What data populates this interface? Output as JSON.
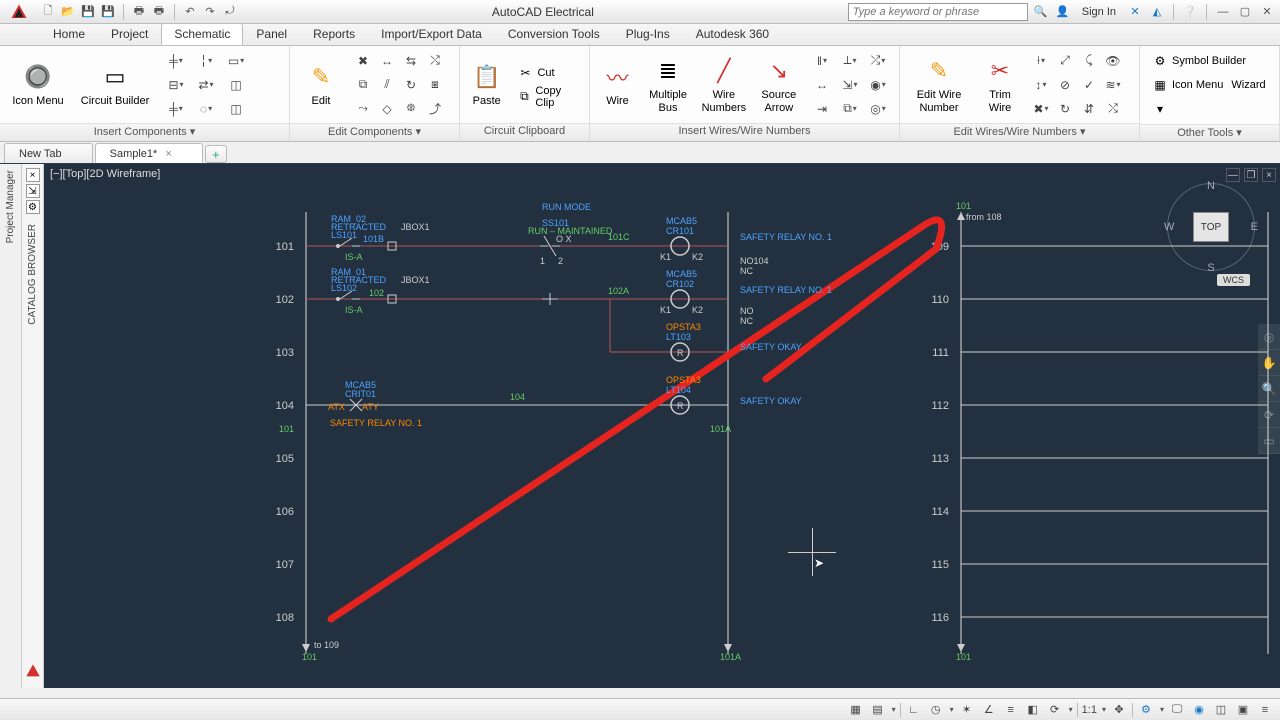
{
  "app": {
    "title": "AutoCAD Electrical",
    "search_placeholder": "Type a keyword or phrase",
    "signin": "Sign In"
  },
  "tabs": {
    "items": [
      "Home",
      "Project",
      "Schematic",
      "Panel",
      "Reports",
      "Import/Export Data",
      "Conversion Tools",
      "Plug-Ins",
      "Autodesk 360"
    ],
    "active": 2
  },
  "ribbon": {
    "insert_components": {
      "title": "Insert Components ▾",
      "icon_menu": "Icon Menu",
      "circuit_builder": "Circuit Builder"
    },
    "edit_components": {
      "title": "Edit Components ▾",
      "edit": "Edit"
    },
    "clipboard": {
      "title": "Circuit Clipboard",
      "paste": "Paste",
      "cut": "Cut",
      "copy": "Copy Clip"
    },
    "insert_wires": {
      "title": "Insert Wires/Wire Numbers",
      "wire": "Wire",
      "multi_bus": "Multiple\nBus",
      "wire_numbers": "Wire\nNumbers",
      "source_arrow": "Source\nArrow"
    },
    "edit_wires": {
      "title": "Edit Wires/Wire Numbers ▾",
      "edit_wire_number": "Edit Wire\nNumber",
      "trim_wire": "Trim\nWire"
    },
    "other_tools": {
      "title": "Other Tools ▾",
      "symbol_builder": "Symbol Builder",
      "icon_menu": "Icon Menu",
      "wizard": "Wizard"
    }
  },
  "docs": {
    "tabs": [
      {
        "label": "New Tab"
      },
      {
        "label": "Sample1*"
      }
    ],
    "active": 1
  },
  "view": {
    "label_parts": [
      "[−]",
      "[Top]",
      "[2D Wireframe]"
    ],
    "cube_face": "TOP",
    "wcs": "WCS"
  },
  "side_panels": {
    "project_manager": "Project Manager",
    "catalog_browser": "CATALOG BROWSER"
  },
  "rungs_left": [
    "101",
    "102",
    "103",
    "104",
    "105",
    "106",
    "107",
    "108"
  ],
  "rungs_right": [
    "109",
    "110",
    "111",
    "112",
    "113",
    "114",
    "115",
    "116"
  ],
  "labels": {
    "wire_101B": "101B",
    "wire_101C": "101C",
    "wire_102": "102",
    "wire_104": "104",
    "wire_101": "101",
    "wire_101A": "101A",
    "wire_102A": "102A",
    "run_mode": "RUN\nMODE",
    "ss101": "SS101",
    "ox": "O X",
    "run_maintained": "RUN – MAINTAINED",
    "one": "1",
    "two": "2",
    "ram_02": "RAM_02",
    "retracted1": "RETRACTED",
    "ls101": "LS101",
    "is_a1": "IS-A",
    "jbox1": "JBOX1",
    "ram_01": "RAM_01",
    "retracted2": "RETRACTED",
    "ls102": "LS102",
    "is_a2": "IS-A",
    "jbox2": "JBOX1",
    "mcab5_1": "MCAB5",
    "cr101_1": "CR101",
    "k1_1": "K1",
    "k2_1": "K2",
    "mcab5_2": "MCAB5",
    "cr102": "CR102",
    "k1_2": "K1",
    "k2_2": "K2",
    "opsta3_1": "OPSTA3",
    "lt103": "LT103",
    "r1": "R",
    "opsta3_2": "OPSTA3",
    "lt104": "LT104",
    "r2": "R",
    "mcab5_3": "MCAB5",
    "crit01": "CRIT01",
    "atx": "ATX",
    "aty": "ATY",
    "safety_relay_1": "SAFETY\nRELAY NO. 1",
    "safety_relay_2": "SAFETY\nRELAY NO. 1",
    "safety_okay_1": "SAFETY\nOKAY",
    "safety_okay_2": "SAFETY\nOKAY",
    "no104": "NO104",
    "nc1": "NC",
    "no": "NO",
    "nc2": "NC",
    "safety_relay_orange": "SAFETY\nRELAY NO. 1",
    "from_108": "from  108",
    "to_109": "to  109",
    "end_101": "101",
    "end_101a": "101A",
    "end_101r": "101"
  },
  "status": {
    "scale": "1:1"
  }
}
